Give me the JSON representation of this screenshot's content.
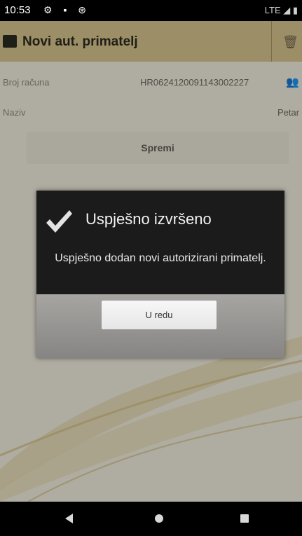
{
  "status_bar": {
    "time": "10:53",
    "left_icons": "⚙ ▪ ⊛",
    "right_icons": "LTE ◢ ▮"
  },
  "app_bar": {
    "title": "Novi aut. primatelj",
    "action_icon": "delete-icon"
  },
  "form": {
    "account_label": "Broj računa",
    "account_value": "HR0624120091143002227",
    "name_label": "Naziv",
    "name_value": "Petar",
    "save_label": "Spremi"
  },
  "dialog": {
    "title": "Uspješno izvršeno",
    "message": "Uspješno dodan novi autorizirani primatelj.",
    "ok_label": "U redu"
  },
  "colors": {
    "app_bar": "#d3c08a",
    "background": "#ece8d9",
    "dialog": "#1b1b1b",
    "check": "#e3e3e3"
  }
}
